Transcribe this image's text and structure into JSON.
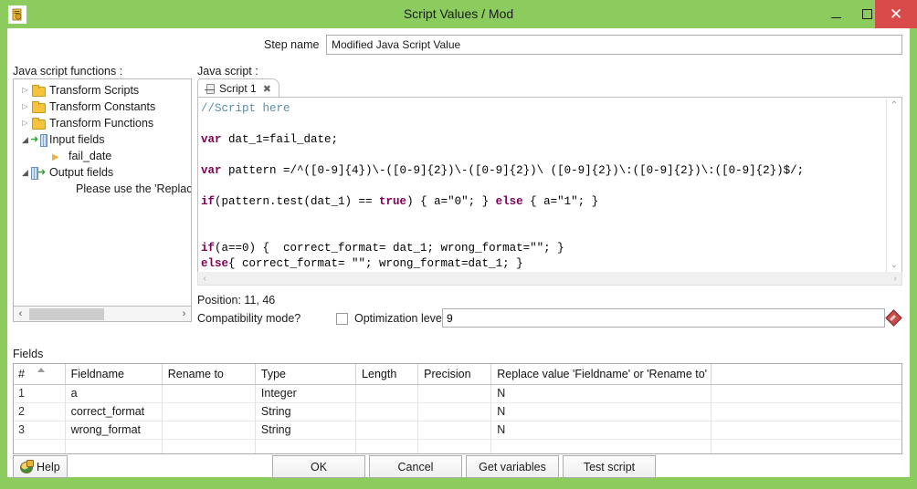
{
  "window": {
    "title": "Script Values / Mod",
    "app_icon": "spoon-script-icon",
    "controls": {
      "minimize": "minimize-icon",
      "maximize": "maximize-icon",
      "close": "close-icon"
    },
    "accent_green": "#8CCB5E",
    "close_red": "#D94A4A"
  },
  "step": {
    "label": "Step name",
    "value": "Modified Java Script Value",
    "placeholder": ""
  },
  "left_panel": {
    "caption": "Java script functions :",
    "tree": [
      {
        "label": "Transform Scripts",
        "icon": "folder-icon",
        "state": "collapsed",
        "indent": 0
      },
      {
        "label": "Transform Constants",
        "icon": "folder-icon",
        "state": "collapsed",
        "indent": 0
      },
      {
        "label": "Transform Functions",
        "icon": "folder-icon",
        "state": "collapsed",
        "indent": 0
      },
      {
        "label": "Input fields",
        "icon": "input-fields-icon",
        "state": "expanded",
        "indent": 0
      },
      {
        "label": "fail_date",
        "icon": "field-icon",
        "state": "leaf",
        "indent": 1
      },
      {
        "label": "Output fields",
        "icon": "output-fields-icon",
        "state": "expanded",
        "indent": 0
      },
      {
        "label": "Please use the 'Replace v",
        "icon": "none",
        "state": "note",
        "indent": 2
      }
    ],
    "hscroll": {
      "left_arrow": "‹",
      "right_arrow": "›"
    }
  },
  "editor": {
    "caption": "Java script :",
    "tab": {
      "label": "Script 1",
      "icon": "script-tab-icon",
      "close": "✖"
    },
    "code_lines": [
      {
        "type": "comment",
        "text": "//Script here"
      },
      {
        "type": "blank",
        "text": ""
      },
      {
        "type": "code",
        "kw": "var",
        "text": " dat_1=fail_date;"
      },
      {
        "type": "blank",
        "text": ""
      },
      {
        "type": "code",
        "kw": "var",
        "text": " pattern =/^([0-9]{4})\\-([0-9]{2})\\-([0-9]{2})\\ ([0-9]{2})\\:([0-9]{2})\\:([0-9]{2})$/;"
      },
      {
        "type": "blank",
        "text": ""
      },
      {
        "type": "code2",
        "text": "if(pattern.test(dat_1) == true) { a=\"0\"; } else { a=\"1\"; }"
      },
      {
        "type": "blank",
        "text": ""
      },
      {
        "type": "blank",
        "text": ""
      },
      {
        "type": "code3",
        "text": "if(a==0) {  correct_format= dat_1; wrong_format=\"\"; }"
      },
      {
        "type": "code4",
        "text": "else{ correct_format= \"\"; wrong_format=dat_1; }"
      }
    ],
    "scroll": {
      "up": "⌃",
      "down": "⌄",
      "left": "‹",
      "right": "›"
    }
  },
  "status": {
    "position": "Position: 11, 46",
    "compatibility_label": "Compatibility mode?",
    "compatibility_checked": false,
    "optimization_label": "Optimization level",
    "optimization_value": "9",
    "variable_icon": "variable-diamond-icon"
  },
  "fields": {
    "caption": "Fields",
    "columns": [
      "#",
      "Fieldname",
      "Rename to",
      "Type",
      "Length",
      "Precision",
      "Replace value 'Fieldname' or 'Rename to'",
      ""
    ],
    "rows": [
      {
        "num": "1",
        "fieldname": "a",
        "rename": "",
        "type": "Integer",
        "length": "",
        "precision": "",
        "replace": "N",
        "extra": ""
      },
      {
        "num": "2",
        "fieldname": "correct_format",
        "rename": "",
        "type": "String",
        "length": "",
        "precision": "",
        "replace": "N",
        "extra": ""
      },
      {
        "num": "3",
        "fieldname": "wrong_format",
        "rename": "",
        "type": "String",
        "length": "",
        "precision": "",
        "replace": "N",
        "extra": ""
      },
      {
        "num": "",
        "fieldname": "",
        "rename": "",
        "type": "",
        "length": "",
        "precision": "",
        "replace": "",
        "extra": ""
      }
    ]
  },
  "buttons": {
    "help": "Help",
    "ok": "OK",
    "cancel": "Cancel",
    "get_variables": "Get variables",
    "test_script": "Test script"
  }
}
